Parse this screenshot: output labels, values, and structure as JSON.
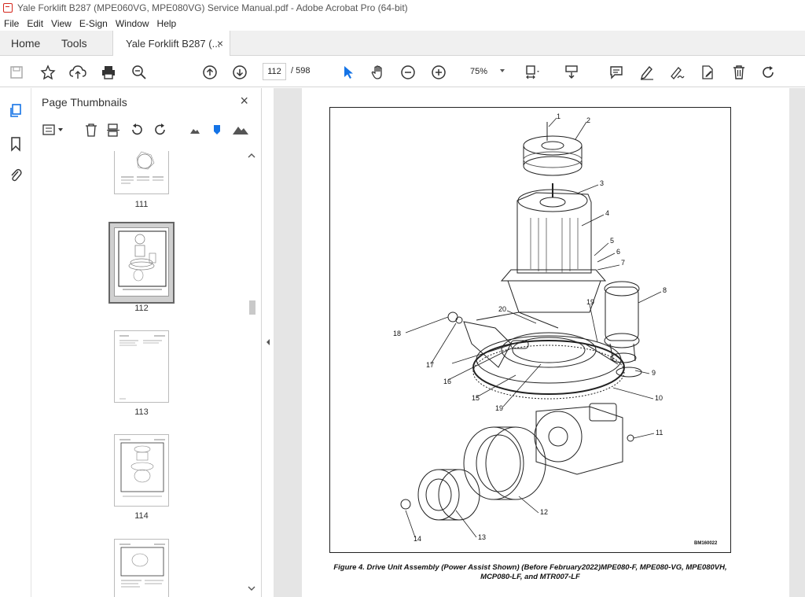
{
  "window": {
    "title": "Yale Forklift B287 (MPE060VG, MPE080VG) Service Manual.pdf - Adobe Acrobat Pro (64-bit)"
  },
  "menu": [
    "File",
    "Edit",
    "View",
    "E-Sign",
    "Window",
    "Help"
  ],
  "tabs": {
    "home": "Home",
    "tools": "Tools",
    "document": "Yale Forklift B287 (...",
    "close": "×"
  },
  "toolbar": {
    "page_current": "112",
    "page_total": "/ 598",
    "zoom": "75%"
  },
  "panel": {
    "title": "Page Thumbnails",
    "close": "×",
    "thumbnails": [
      {
        "label": "111"
      },
      {
        "label": "112",
        "selected": true
      },
      {
        "label": "113"
      },
      {
        "label": "114"
      },
      {
        "label": ""
      }
    ]
  },
  "figure": {
    "callouts": [
      "1",
      "2",
      "3",
      "4",
      "5",
      "6",
      "7",
      "8",
      "9",
      "10",
      "11",
      "12",
      "13",
      "14",
      "15",
      "16",
      "17",
      "18",
      "19",
      "19",
      "20"
    ],
    "code": "BM160022",
    "caption": "Figure 4. Drive Unit Assembly (Power Assist Shown) (Before February2022)MPE080-F, MPE080-VG, MPE080VH, MCP080-LF, and MTR007-LF"
  },
  "colors": {
    "accent": "#1473e6",
    "tab_bg": "#f0f0f0",
    "viewer_bg": "#e5e5e5",
    "acrobat_red": "#d4261c"
  }
}
